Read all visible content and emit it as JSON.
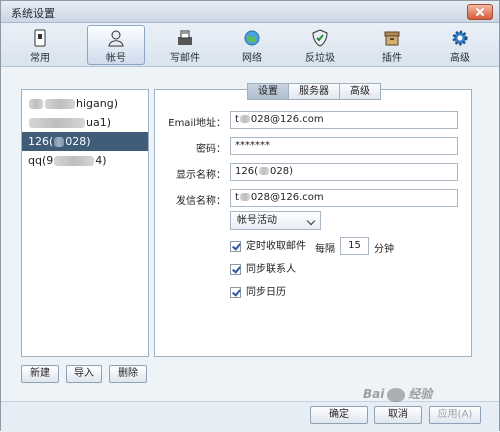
{
  "window": {
    "title": "系统设置"
  },
  "toolbar": {
    "items": [
      {
        "label": "常用",
        "icon": "sim-card-icon"
      },
      {
        "label": "帐号",
        "icon": "user-icon"
      },
      {
        "label": "写邮件",
        "icon": "compose-icon"
      },
      {
        "label": "网络",
        "icon": "globe-icon"
      },
      {
        "label": "反垃圾",
        "icon": "shield-icon"
      },
      {
        "label": "插件",
        "icon": "plugin-box-icon"
      },
      {
        "label": "高级",
        "icon": "gear-icon"
      }
    ],
    "active_index": 1
  },
  "accounts": {
    "items": [
      {
        "pre": "",
        "post": "higang)"
      },
      {
        "pre": "",
        "post": "ua1)"
      },
      {
        "pre": "126(",
        "post": "028)"
      },
      {
        "pre": "qq(9",
        "post": "4)"
      }
    ],
    "selected_index": 2
  },
  "tabs": {
    "items": [
      "设置",
      "服务器",
      "高级"
    ],
    "active_index": 0
  },
  "form": {
    "email_label": "Email地址：",
    "email_pre": "t",
    "email_post": "028@126.com",
    "password_label": "密码：",
    "password_value": "*******",
    "display_label": "显示名称：",
    "display_pre": "126(",
    "display_post": "028)",
    "sender_label": "发信名称：",
    "sender_pre": "t",
    "sender_post": "028@126.com",
    "activity_select": "帐号活动",
    "timed_receive_label": "定时收取邮件",
    "interval_prefix": "每隔",
    "interval_value": "15",
    "interval_unit": "分钟",
    "sync_contacts_label": "同步联系人",
    "sync_calendar_label": "同步日历"
  },
  "left_buttons": {
    "new": "新建",
    "import": "导入",
    "delete": "删除"
  },
  "bottom_buttons": {
    "ok": "确定",
    "cancel": "取消",
    "apply": "应用(A)"
  },
  "watermark": {
    "text_a": "Bai",
    "text_b": "经验"
  }
}
